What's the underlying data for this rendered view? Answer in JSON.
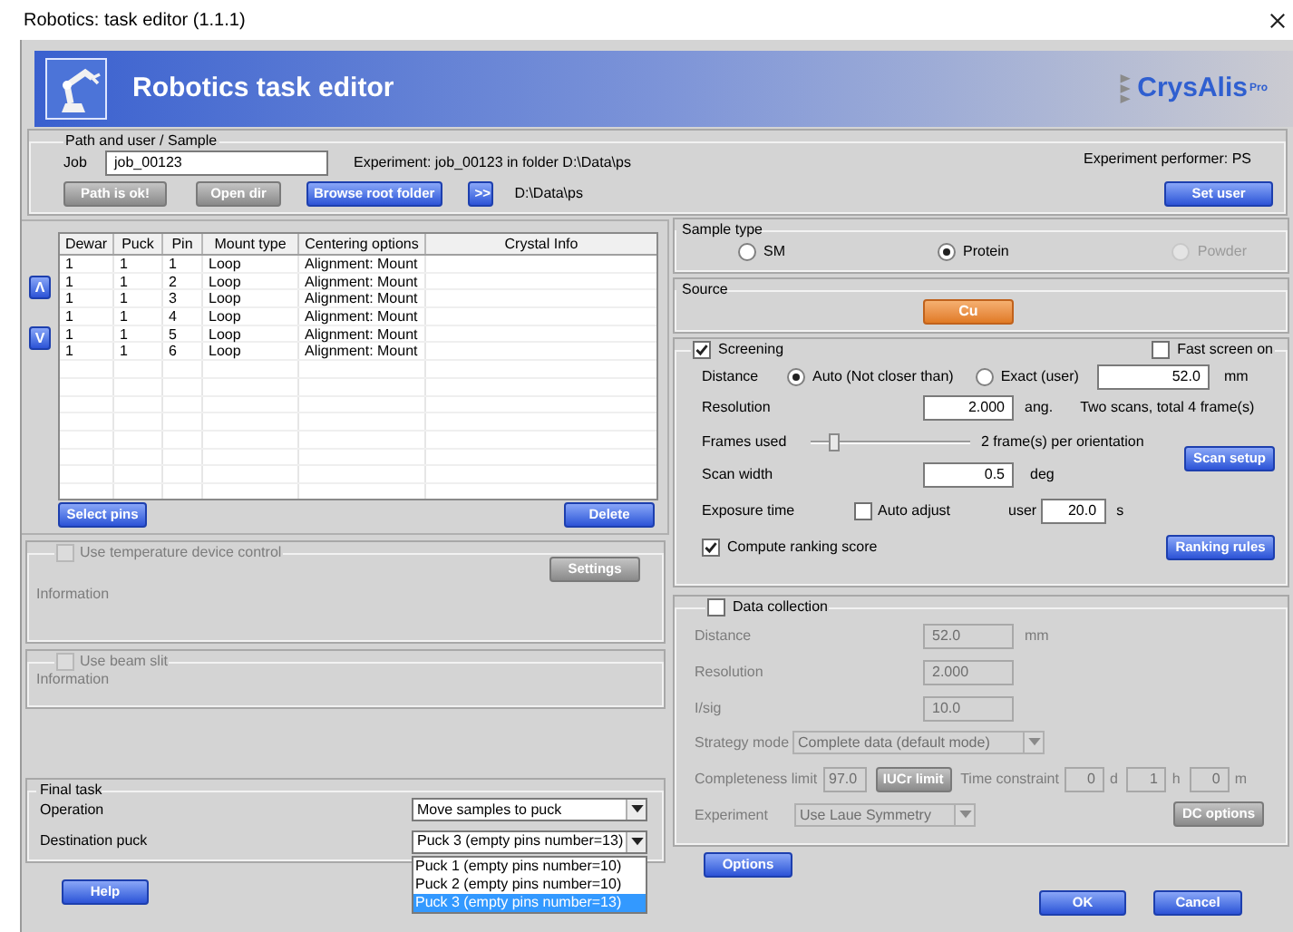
{
  "window": {
    "title": "Robotics: task editor (1.1.1)"
  },
  "header": {
    "title": "Robotics task editor",
    "logo": "CrysAlis",
    "logo_badge": "Pro"
  },
  "path_group": {
    "legend": "Path and user / Sample",
    "job_label": "Job",
    "job_value": "job_00123",
    "experiment_info": "Experiment: job_00123 in folder D:\\Data\\ps",
    "performer": "Experiment performer: PS",
    "buttons": [
      {
        "label": "Path is ok!",
        "disabled": true
      },
      {
        "label": "Open dir",
        "disabled": true
      },
      {
        "label": "Browse root folder",
        "disabled": false
      },
      {
        "label": ">>",
        "disabled": false
      }
    ],
    "path": "D:\\Data\\ps",
    "set_user": "Set user"
  },
  "move_buttons": [
    "Λ",
    "V"
  ],
  "table": {
    "columns": [
      "Dewar",
      "Puck",
      "Pin",
      "Mount type",
      "Centering options",
      "Crystal Info"
    ],
    "rows": [
      [
        "1",
        "1",
        "1",
        "Loop",
        "Alignment: Mount"
      ],
      [
        "1",
        "1",
        "2",
        "Loop",
        "Alignment: Mount"
      ],
      [
        "1",
        "1",
        "3",
        "Loop",
        "Alignment: Mount"
      ],
      [
        "1",
        "1",
        "4",
        "Loop",
        "Alignment: Mount"
      ],
      [
        "1",
        "1",
        "5",
        "Loop",
        "Alignment: Mount"
      ],
      [
        "1",
        "1",
        "6",
        "Loop",
        "Alignment: Mount"
      ]
    ]
  },
  "table_buttons": [
    "Select pins",
    "Delete"
  ],
  "temperature": {
    "label": "Use temperature device control",
    "checked": false,
    "disabled": true,
    "info": "Information",
    "settings": "Settings"
  },
  "beam_slit": {
    "label": "Use beam slit",
    "checked": false,
    "disabled": true,
    "info": "Information"
  },
  "final_task": {
    "legend": "Final task",
    "operation": {
      "label": "Operation",
      "value": "Move samples to puck"
    },
    "destination": {
      "label": "Destination puck",
      "value": "Puck 3 (empty pins number=13)",
      "options": [
        {
          "label": "Puck 1 (empty pins number=10)",
          "selected": false
        },
        {
          "label": "Puck 2 (empty pins number=10)",
          "selected": false
        },
        {
          "label": "Puck 3 (empty pins number=13)",
          "selected": true
        }
      ]
    }
  },
  "help": "Help",
  "sample_type": {
    "legend": "Sample type",
    "options": [
      {
        "label": "SM",
        "selected": false,
        "disabled": false
      },
      {
        "label": "Protein",
        "selected": true,
        "disabled": false
      },
      {
        "label": "Powder",
        "selected": false,
        "disabled": true
      }
    ]
  },
  "source": {
    "legend": "Source",
    "button": "Cu"
  },
  "screening": {
    "label": "Screening",
    "checked": true,
    "fast_screen": {
      "label": "Fast screen on",
      "checked": false
    },
    "distance": {
      "label": "Distance",
      "options": [
        {
          "label": "Auto (Not closer than)",
          "selected": true
        },
        {
          "label": "Exact (user)",
          "selected": false
        }
      ],
      "value": "52.0",
      "unit": "mm"
    },
    "resolution": {
      "label": "Resolution",
      "value": "2.000",
      "unit": "ang.",
      "note": "Two scans, total 4 frame(s)"
    },
    "frames": {
      "label": "Frames used",
      "level": 0.15,
      "reading": "2 frame(s) per orientation"
    },
    "scan_setup": "Scan setup",
    "scan_width": {
      "label": "Scan width",
      "value": "0.5",
      "unit": "deg"
    },
    "exposure": {
      "label": "Exposure time",
      "auto_label": "Auto adjust",
      "auto_checked": false,
      "user_label": "user",
      "value": "20.0",
      "unit": "s"
    },
    "ranking": {
      "label": "Compute ranking score",
      "checked": true
    },
    "ranking_rules": "Ranking rules"
  },
  "data_collection": {
    "label": "Data collection",
    "checked": false,
    "distance": {
      "label": "Distance",
      "value": "52.0",
      "unit": "mm"
    },
    "resolution": {
      "label": "Resolution",
      "value": "2.000"
    },
    "isig": {
      "label": "I/sig",
      "value": "10.0"
    },
    "strategy": {
      "label": "Strategy mode",
      "value": "Complete data (default mode)"
    },
    "completeness": {
      "label": "Completeness limit",
      "value": "97.0",
      "button": "IUCr limit"
    },
    "time": {
      "label": "Time constraint",
      "fields": [
        {
          "value": "0",
          "unit": "d"
        },
        {
          "value": "1",
          "unit": "h"
        },
        {
          "value": "0",
          "unit": "m"
        }
      ]
    },
    "experiment": {
      "label": "Experiment",
      "value": "Use Laue Symmetry"
    },
    "dc_options": "DC options"
  },
  "bottom_buttons": {
    "options": "Options",
    "ok": "OK",
    "cancel": "Cancel"
  }
}
